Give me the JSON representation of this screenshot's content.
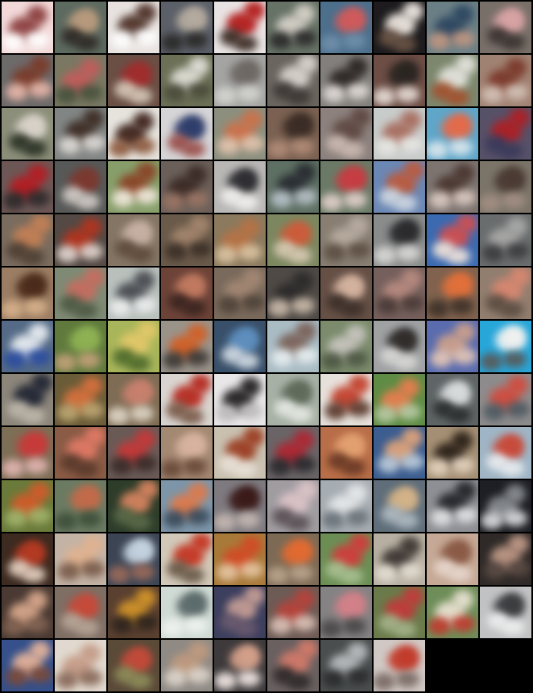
{
  "image_grid": {
    "columns": 10,
    "tile_count": 127,
    "tiles": [
      {
        "bg": "#f2d8d8",
        "c1": "#8a3c3c",
        "c2": "#ffffff"
      },
      {
        "bg": "#5d6a60",
        "c1": "#b89a7d",
        "c2": "#2f2a26"
      },
      {
        "bg": "#e7e2df",
        "c1": "#4b2f25",
        "c2": "#ffffff"
      },
      {
        "bg": "#5b5f68",
        "c1": "#b5ab9f",
        "c2": "#2b2a28"
      },
      {
        "bg": "#e8e3e2",
        "c1": "#b21818",
        "c2": "#3b2b24"
      },
      {
        "bg": "#677266",
        "c1": "#d7d2c9",
        "c2": "#2a2a2a"
      },
      {
        "bg": "#4c6f8c",
        "c1": "#d15a5a",
        "c2": "#6f8ea9"
      },
      {
        "bg": "#1d1b1d",
        "c1": "#f2ebe4",
        "c2": "#6a5446"
      },
      {
        "bg": "#6a7f85",
        "c1": "#2c4660",
        "c2": "#bf9581"
      },
      {
        "bg": "#796f69",
        "c1": "#d8a3a4",
        "c2": "#3b3431"
      },
      {
        "bg": "#6d6a6a",
        "c1": "#7a3b2a",
        "c2": "#e6b5a8"
      },
      {
        "bg": "#7a7862",
        "c1": "#c25c5c",
        "c2": "#47533d"
      },
      {
        "bg": "#6a4f45",
        "c1": "#a02d2d",
        "c2": "#d5c6b6"
      },
      {
        "bg": "#6c7056",
        "c1": "#e0e0d8",
        "c2": "#4a4b3a"
      },
      {
        "bg": "#a4a4a2",
        "c1": "#6e6864",
        "c2": "#d3d3d0"
      },
      {
        "bg": "#6b655f",
        "c1": "#d9d5cf",
        "c2": "#3c3835"
      },
      {
        "bg": "#83807c",
        "c1": "#2b2522",
        "c2": "#ded9d5"
      },
      {
        "bg": "#6c4e45",
        "c1": "#2a2521",
        "c2": "#e5dad4"
      },
      {
        "bg": "#7c876e",
        "c1": "#e4e4dd",
        "c2": "#a3512e"
      },
      {
        "bg": "#a08273",
        "c1": "#7a3829",
        "c2": "#d2c0b5"
      },
      {
        "bg": "#8b8e79",
        "c1": "#d8d2c8",
        "c2": "#2c3326"
      },
      {
        "bg": "#818584",
        "c1": "#3c2c24",
        "c2": "#dcd8d4"
      },
      {
        "bg": "#e6e3dd",
        "c1": "#3a1f18",
        "c2": "#8e5c40"
      },
      {
        "bg": "#d5d4d6",
        "c1": "#2d3c6a",
        "c2": "#9a4f4a"
      },
      {
        "bg": "#8c8f7e",
        "c1": "#cd714a",
        "c2": "#e0c3ad"
      },
      {
        "bg": "#7a6151",
        "c1": "#3a2c25",
        "c2": "#b08a77"
      },
      {
        "bg": "#8c817d",
        "c1": "#5f4843",
        "c2": "#cab8b0"
      },
      {
        "bg": "#c7cbc9",
        "c1": "#a76b5d",
        "c2": "#e6e6e3"
      },
      {
        "bg": "#5fa6c9",
        "c1": "#e46a49",
        "c2": "#d9e6ec"
      },
      {
        "bg": "#575168",
        "c1": "#b01f24",
        "c2": "#3a3a5a"
      },
      {
        "bg": "#6d5756",
        "c1": "#b61c22",
        "c2": "#2d2a2b"
      },
      {
        "bg": "#575958",
        "c1": "#7b3930",
        "c2": "#d0cac5"
      },
      {
        "bg": "#879e6a",
        "c1": "#8a4226",
        "c2": "#f0e8db"
      },
      {
        "bg": "#6b5f59",
        "c1": "#3a2a25",
        "c2": "#9a7564"
      },
      {
        "bg": "#b8b7b5",
        "c1": "#2e2d31",
        "c2": "#f0efee"
      },
      {
        "bg": "#5e6f63",
        "c1": "#272b30",
        "c2": "#b5c0c6"
      },
      {
        "bg": "#6a7a66",
        "c1": "#c83c42",
        "c2": "#e0cec9"
      },
      {
        "bg": "#6b87b4",
        "c1": "#bc5a3c",
        "c2": "#cdd6e0"
      },
      {
        "bg": "#7d7470",
        "c1": "#4a3630",
        "c2": "#d9c8c1"
      },
      {
        "bg": "#7b7468",
        "c1": "#4a3a33",
        "c2": "#a28e83"
      },
      {
        "bg": "#7a6c5e",
        "c1": "#c48055",
        "c2": "#4f4034"
      },
      {
        "bg": "#544944",
        "c1": "#b3341f",
        "c2": "#e0d3cd"
      },
      {
        "bg": "#847565",
        "c1": "#c6b0a3",
        "c2": "#5f4b3d"
      },
      {
        "bg": "#6a5a4a",
        "c1": "#a4866e",
        "c2": "#3b3027"
      },
      {
        "bg": "#8b7a5e",
        "c1": "#b77245",
        "c2": "#d9c2a0"
      },
      {
        "bg": "#7c8760",
        "c1": "#cc5c3b",
        "c2": "#d6c9b2"
      },
      {
        "bg": "#887e72",
        "c1": "#b8aca1",
        "c2": "#5c4e42"
      },
      {
        "bg": "#8a8c8b",
        "c1": "#2a2a2c",
        "c2": "#d8d7d6"
      },
      {
        "bg": "#3c6ab0",
        "c1": "#d14f4f",
        "c2": "#efe2d9"
      },
      {
        "bg": "#6a6d6e",
        "c1": "#a9a9a8",
        "c2": "#3b3c3d"
      },
      {
        "bg": "#9a7d63",
        "c1": "#4a2a1a",
        "c2": "#d6b08a"
      },
      {
        "bg": "#7f8a74",
        "c1": "#c76c5f",
        "c2": "#4e5a45"
      },
      {
        "bg": "#b9c0bc",
        "c1": "#47494f",
        "c2": "#eceeee"
      },
      {
        "bg": "#6d4338",
        "c1": "#c17a60",
        "c2": "#3b2520"
      },
      {
        "bg": "#7a6a5c",
        "c1": "#a48874",
        "c2": "#4f4339"
      },
      {
        "bg": "#4f4a46",
        "c1": "#2c2a2a",
        "c2": "#c9b9a8"
      },
      {
        "bg": "#665046",
        "c1": "#d4b39f",
        "c2": "#3d302a"
      },
      {
        "bg": "#76605d",
        "c1": "#b88b80",
        "c2": "#4a3b38"
      },
      {
        "bg": "#80624e",
        "c1": "#e2703a",
        "c2": "#3f3229"
      },
      {
        "bg": "#917e6f",
        "c1": "#d98770",
        "c2": "#5c4d42"
      },
      {
        "bg": "#546a86",
        "c1": "#e9eef2",
        "c2": "#2b4ca0"
      },
      {
        "bg": "#5f7a3c",
        "c1": "#8fb254",
        "c2": "#c2a07a"
      },
      {
        "bg": "#a8b55a",
        "c1": "#e3c86a",
        "c2": "#4e6b2c"
      },
      {
        "bg": "#9a938a",
        "c1": "#d35f25",
        "c2": "#3d3a36"
      },
      {
        "bg": "#39506a",
        "c1": "#5e8fbf",
        "c2": "#cfd9e2"
      },
      {
        "bg": "#a9bcc4",
        "c1": "#7a6158",
        "c2": "#e6edef"
      },
      {
        "bg": "#7b8b6c",
        "c1": "#c8c5bf",
        "c2": "#4d5743"
      },
      {
        "bg": "#9fa1a3",
        "c1": "#2f2c2a",
        "c2": "#d7d7d5"
      },
      {
        "bg": "#5a6cae",
        "c1": "#cda08a",
        "c2": "#e3c5b6"
      },
      {
        "bg": "#27a6d8",
        "c1": "#f1f1ef",
        "c2": "#595a5a"
      },
      {
        "bg": "#8b857a",
        "c1": "#202533",
        "c2": "#bdb6aa"
      },
      {
        "bg": "#6b5c38",
        "c1": "#d6703d",
        "c2": "#bba571"
      },
      {
        "bg": "#7e6c54",
        "c1": "#c9806e",
        "c2": "#ddd4c4"
      },
      {
        "bg": "#d9d4cf",
        "c1": "#b5261c",
        "c2": "#7a5b4a"
      },
      {
        "bg": "#e8e6e6",
        "c1": "#1e1c1c",
        "c2": "#bebcbc"
      },
      {
        "bg": "#a7b0a4",
        "c1": "#5f6a5a",
        "c2": "#e4e8e2"
      },
      {
        "bg": "#e6e0da",
        "c1": "#c23e2a",
        "c2": "#5b3a2d"
      },
      {
        "bg": "#5f8c45",
        "c1": "#e87d4e",
        "c2": "#b6c8a3"
      },
      {
        "bg": "#5f6566",
        "c1": "#d8dbdc",
        "c2": "#2b2e2f"
      },
      {
        "bg": "#8e8b8c",
        "c1": "#d24b3d",
        "c2": "#4e5b62"
      },
      {
        "bg": "#7d6e56",
        "c1": "#c83a3a",
        "c2": "#e1b4b0"
      },
      {
        "bg": "#8a5b45",
        "c1": "#e17a66",
        "c2": "#5a3a2c"
      },
      {
        "bg": "#6a5a56",
        "c1": "#c73838",
        "c2": "#3a2c29"
      },
      {
        "bg": "#a38872",
        "c1": "#d8b4a0",
        "c2": "#6a4a3a"
      },
      {
        "bg": "#c9c0b0",
        "c1": "#9a3b1f",
        "c2": "#e8e0d6"
      },
      {
        "bg": "#6a6466",
        "c1": "#b02632",
        "c2": "#2a2a2e"
      },
      {
        "bg": "#b86e48",
        "c1": "#e3a070",
        "c2": "#6a3a25"
      },
      {
        "bg": "#3c5d8f",
        "c1": "#e0a47a",
        "c2": "#b9c9d9"
      },
      {
        "bg": "#a48f74",
        "c1": "#2a2017",
        "c2": "#e2d1bd"
      },
      {
        "bg": "#9fb4c4",
        "c1": "#c84a3a",
        "c2": "#e8ecef"
      },
      {
        "bg": "#6a7a3a",
        "c1": "#d35a2a",
        "c2": "#a0b26a"
      },
      {
        "bg": "#6b7b62",
        "c1": "#c36a4a",
        "c2": "#3e4f3a"
      },
      {
        "bg": "#2e3d2a",
        "c1": "#d98560",
        "c2": "#5a6a48"
      },
      {
        "bg": "#7d95a8",
        "c1": "#e07a4a",
        "c2": "#3a4a5a"
      },
      {
        "bg": "#7e7a80",
        "c1": "#3a1a18",
        "c2": "#c3b6b0"
      },
      {
        "bg": "#a09ca0",
        "c1": "#dcc4c8",
        "c2": "#5a5055"
      },
      {
        "bg": "#a6adb2",
        "c1": "#e6e8ea",
        "c2": "#6a737a"
      },
      {
        "bg": "#5f6e7a",
        "c1": "#d4b388",
        "c2": "#aeb8c0"
      },
      {
        "bg": "#8d8f94",
        "c1": "#222428",
        "c2": "#e0e1e3"
      },
      {
        "bg": "#1d1f24",
        "c1": "#8a8d92",
        "c2": "#d9dadc"
      },
      {
        "bg": "#3d2a20",
        "c1": "#b43a22",
        "c2": "#e4cfbf"
      },
      {
        "bg": "#c3b3a5",
        "c1": "#e0b28f",
        "c2": "#7a5b4a"
      },
      {
        "bg": "#3c4554",
        "c1": "#c5d3e0",
        "c2": "#9a6a5a"
      },
      {
        "bg": "#d2c8b8",
        "c1": "#c4321f",
        "c2": "#6a5a48"
      },
      {
        "bg": "#a87a3a",
        "c1": "#d24a25",
        "c2": "#e4c4a0"
      },
      {
        "bg": "#7d6a55",
        "c1": "#e36a30",
        "c2": "#b7a28a"
      },
      {
        "bg": "#6c8e55",
        "c1": "#d33b3b",
        "c2": "#a8bf90"
      },
      {
        "bg": "#b7b0a2",
        "c1": "#3a3330",
        "c2": "#e4ddd2"
      },
      {
        "bg": "#c5a895",
        "c1": "#8a5a45",
        "c2": "#e6d6cc"
      },
      {
        "bg": "#2f2a28",
        "c1": "#c09a88",
        "c2": "#5a4a44"
      },
      {
        "bg": "#4a3a33",
        "c1": "#d9a88c",
        "c2": "#826352"
      },
      {
        "bg": "#7f6e64",
        "c1": "#c64a3a",
        "c2": "#b6a596"
      },
      {
        "bg": "#5a4030",
        "c1": "#d2942a",
        "c2": "#2e241e"
      },
      {
        "bg": "#cfdad4",
        "c1": "#5b6a6a",
        "c2": "#eef2ef"
      },
      {
        "bg": "#3d3f5e",
        "c1": "#c69e96",
        "c2": "#6a5a6e"
      },
      {
        "bg": "#6d5b55",
        "c1": "#b7423a",
        "c2": "#d9c0b5"
      },
      {
        "bg": "#858283",
        "c1": "#d48088",
        "c2": "#4b4849"
      },
      {
        "bg": "#6a7a4a",
        "c1": "#c23a3a",
        "c2": "#a4b28a"
      },
      {
        "bg": "#6e8d58",
        "c1": "#eae2d2",
        "c2": "#c23a30"
      },
      {
        "bg": "#c1c2c3",
        "c1": "#3a3c3f",
        "c2": "#eceded"
      },
      {
        "bg": "#35508a",
        "c1": "#e6b49a",
        "c2": "#7a4a3a"
      },
      {
        "bg": "#e1d9cf",
        "c1": "#c49a86",
        "c2": "#8a6a5a"
      },
      {
        "bg": "#5a4a38",
        "c1": "#c24a3a",
        "c2": "#8e8c5a"
      },
      {
        "bg": "#8f8a84",
        "c1": "#c09a7f",
        "c2": "#dcd4cb"
      },
      {
        "bg": "#3e3a3c",
        "c1": "#d4a08a",
        "c2": "#f0e6e2"
      },
      {
        "bg": "#6a6060",
        "c1": "#d37a6a",
        "c2": "#2f2a2a"
      },
      {
        "bg": "#4b4e4e",
        "c1": "#b8bdc0",
        "c2": "#2a2c2c"
      },
      {
        "bg": "#d0c8c4",
        "c1": "#c23a2a",
        "c2": "#7a6a64"
      }
    ]
  }
}
